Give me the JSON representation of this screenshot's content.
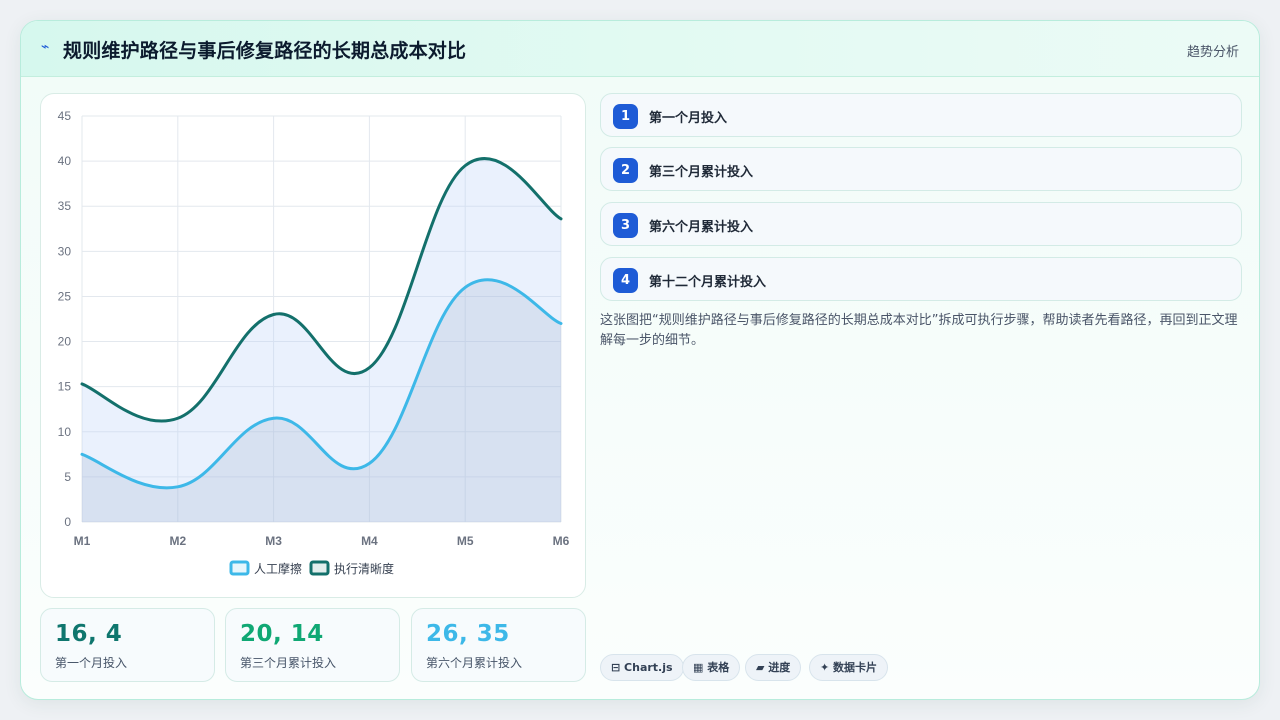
{
  "header": {
    "icon": "⌁",
    "title": "规则维护路径与事后修复路径的长期总成本对比",
    "tag": "趋势分析"
  },
  "chart_data": {
    "type": "area",
    "categories": [
      "M1",
      "M2",
      "M3",
      "M4",
      "M5",
      "M6"
    ],
    "series": [
      {
        "name": "人工摩擦",
        "values": [
          7.5,
          3.9,
          11.5,
          6.5,
          26,
          22
        ],
        "color": "#3db8e8"
      },
      {
        "name": "执行清晰度",
        "values": [
          15.3,
          11.5,
          23,
          17.1,
          39.5,
          33.6
        ],
        "color": "#13706b"
      }
    ],
    "ylim": [
      0,
      45
    ],
    "yticks": [
      0,
      5,
      10,
      15,
      20,
      25,
      30,
      35,
      40,
      45
    ],
    "grid": true,
    "legend_position": "bottom"
  },
  "stats": [
    {
      "value": "16, 4",
      "label": "第一个月投入",
      "color": "#0f766e"
    },
    {
      "value": "20, 14",
      "label": "第三个月累计投入",
      "color": "#10a874"
    },
    {
      "value": "26, 35",
      "label": "第六个月累计投入",
      "color": "#3db8e8"
    }
  ],
  "steps": [
    {
      "num": "1",
      "label": "第一个月投入"
    },
    {
      "num": "2",
      "label": "第三个月累计投入"
    },
    {
      "num": "3",
      "label": "第六个月累计投入"
    },
    {
      "num": "4",
      "label": "第十二个月累计投入"
    }
  ],
  "description": "这张图把“规则维护路径与事后修复路径的长期总成本对比”拆成可执行步骤，帮助读者先看路径，再回到正文理解每一步的细节。",
  "chips": [
    {
      "label": "⊟ Chart.js"
    },
    {
      "label": "▦ 表格"
    },
    {
      "label": "▰ 进度"
    },
    {
      "label": "✦ 数据卡片"
    }
  ]
}
